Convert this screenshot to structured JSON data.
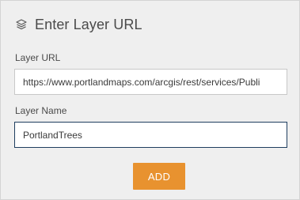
{
  "header": {
    "icon": "layers-icon",
    "title": "Enter Layer URL"
  },
  "form": {
    "url_label": "Layer URL",
    "url_value": "https://www.portlandmaps.com/arcgis/rest/services/Publi",
    "name_label": "Layer Name",
    "name_value": "PortlandTrees"
  },
  "actions": {
    "add_label": "ADD"
  },
  "colors": {
    "accent": "#e8922f",
    "focus_border": "#1f3e5f",
    "panel_bg": "#efefef"
  }
}
